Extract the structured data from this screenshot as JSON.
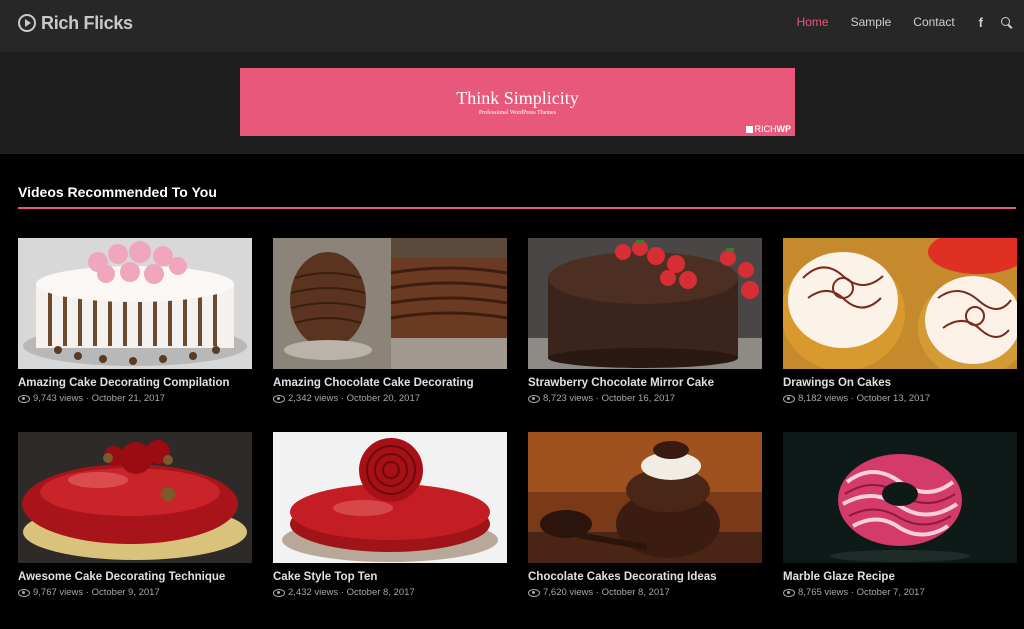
{
  "header": {
    "logo_text": "Rich Flicks",
    "nav": [
      {
        "label": "Home",
        "active": true
      },
      {
        "label": "Sample",
        "active": false
      },
      {
        "label": "Contact",
        "active": false
      }
    ],
    "facebook_glyph": "f",
    "icons": [
      "play-circle-icon",
      "facebook-icon",
      "search-icon"
    ]
  },
  "banner": {
    "title": "Think Simplicity",
    "subtitle": "Professional WordPress Themes",
    "brand_light": "RICH",
    "brand_bold": "WP"
  },
  "section": {
    "title": "Videos Recommended To You"
  },
  "colors": {
    "accent": "#e8587c",
    "banner": "#e8587a",
    "header_bg": "#272727",
    "page_bg": "#000000"
  },
  "videos": [
    {
      "title": "Amazing Cake Decorating Compilation",
      "views": "9,743 views",
      "date": "October 21, 2017"
    },
    {
      "title": "Amazing Chocolate Cake Decorating",
      "views": "2,342 views",
      "date": "October 20, 2017"
    },
    {
      "title": "Strawberry Chocolate Mirror Cake",
      "views": "8,723 views",
      "date": "October 16, 2017"
    },
    {
      "title": "Drawings On Cakes",
      "views": "8,182 views",
      "date": "October 13, 2017"
    },
    {
      "title": "Awesome Cake Decorating Technique",
      "views": "9,767 views",
      "date": "October 9, 2017"
    },
    {
      "title": "Cake Style Top Ten",
      "views": "2,432 views",
      "date": "October 8, 2017"
    },
    {
      "title": "Chocolate Cakes Decorating Ideas",
      "views": "7,620 views",
      "date": "October 8, 2017"
    },
    {
      "title": "Marble Glaze Recipe",
      "views": "8,765 views",
      "date": "October 7, 2017"
    }
  ]
}
